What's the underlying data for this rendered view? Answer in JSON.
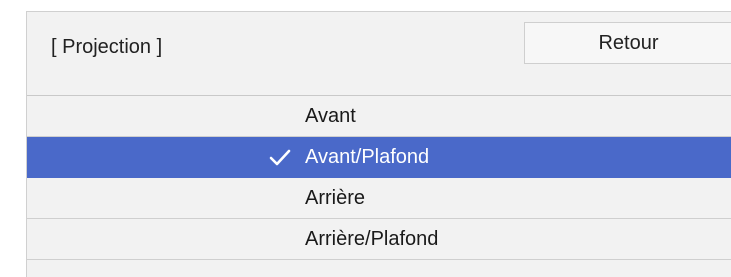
{
  "header": {
    "title": "[ Projection ]",
    "back_label": "Retour"
  },
  "options": [
    {
      "label": "Avant",
      "selected": false
    },
    {
      "label": "Avant/Plafond",
      "selected": true
    },
    {
      "label": "Arrière",
      "selected": false
    },
    {
      "label": "Arrière/Plafond",
      "selected": false
    }
  ],
  "colors": {
    "selected_background": "#4a69c9",
    "panel_background": "#f2f2f2"
  },
  "icons": {
    "selected_marker": "checkmark-icon"
  }
}
